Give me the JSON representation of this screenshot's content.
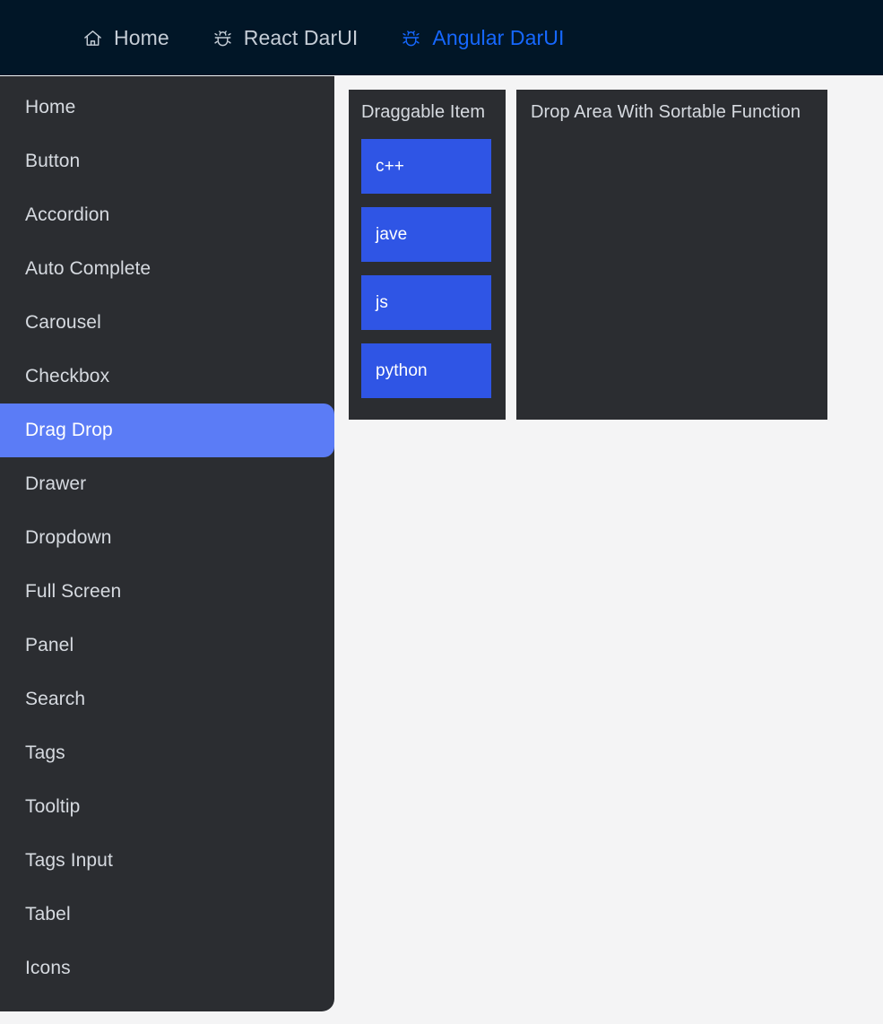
{
  "navbar": {
    "links": [
      {
        "label": "Home",
        "icon": "home-icon",
        "active": false
      },
      {
        "label": "React DarUI",
        "icon": "bug-icon",
        "active": false
      },
      {
        "label": "Angular DarUI",
        "icon": "bug-icon",
        "active": true
      }
    ],
    "background_color": "#011627",
    "inactive_color": "#c5cdd6",
    "active_color": "#1668ff"
  },
  "sidebar": {
    "background_color": "#2b2d31",
    "active_color": "#5b7cf6",
    "items": [
      {
        "label": "Home"
      },
      {
        "label": "Button"
      },
      {
        "label": "Accordion"
      },
      {
        "label": "Auto Complete"
      },
      {
        "label": "Carousel"
      },
      {
        "label": "Checkbox"
      },
      {
        "label": "Drag Drop"
      },
      {
        "label": "Drawer"
      },
      {
        "label": "Dropdown"
      },
      {
        "label": "Full Screen"
      },
      {
        "label": "Panel"
      },
      {
        "label": "Search"
      },
      {
        "label": "Tags"
      },
      {
        "label": "Tooltip"
      },
      {
        "label": "Tags Input"
      },
      {
        "label": "Tabel"
      },
      {
        "label": "Icons"
      }
    ],
    "active_index": 6
  },
  "main": {
    "background_color": "#f4f4f5",
    "draggable_panel": {
      "title": "Draggable Item",
      "item_color": "#2f55e5",
      "items": [
        {
          "label": "c++"
        },
        {
          "label": "jave"
        },
        {
          "label": "js"
        },
        {
          "label": "python"
        }
      ]
    },
    "drop_panel": {
      "title": "Drop Area With Sortable Function",
      "items": []
    }
  }
}
